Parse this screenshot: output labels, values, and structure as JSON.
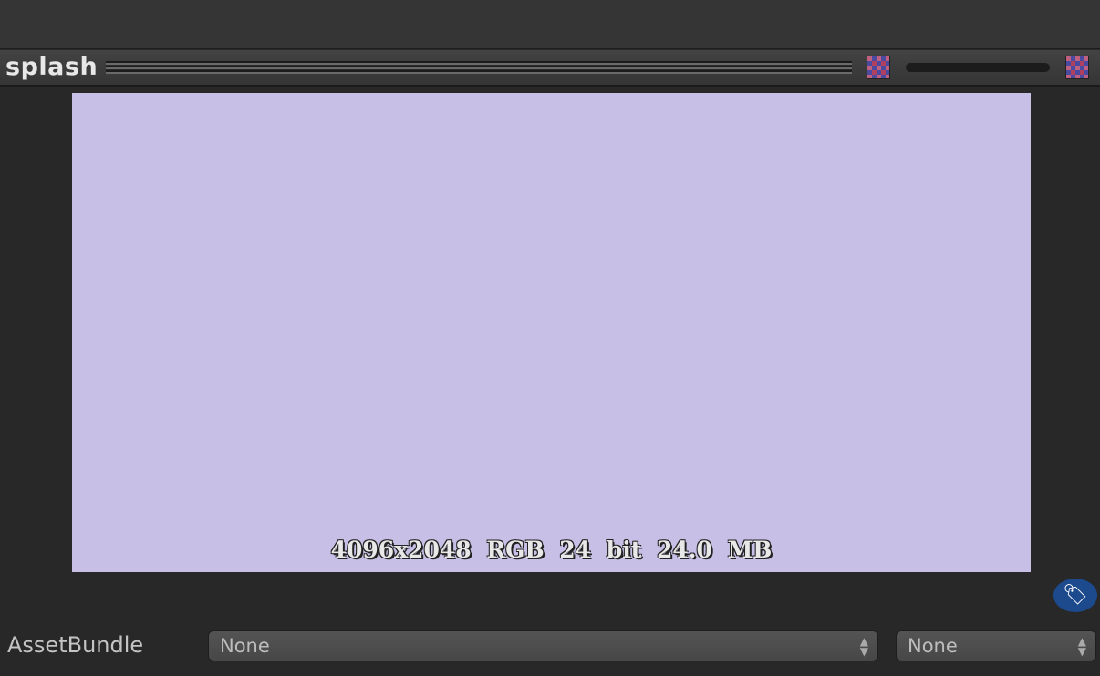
{
  "inspector": {
    "title": "splash",
    "preview_info": "4096x2048  RGB 24 bit   24.0 MB",
    "preview_color": "#c8bfe6"
  },
  "asset_bundle": {
    "label": "AssetBundle",
    "name_value": "None",
    "variant_value": "None"
  },
  "icons": {
    "alpha_toggle": "checker-icon",
    "mip_toggle": "checker-icon",
    "label": "tag-icon"
  }
}
